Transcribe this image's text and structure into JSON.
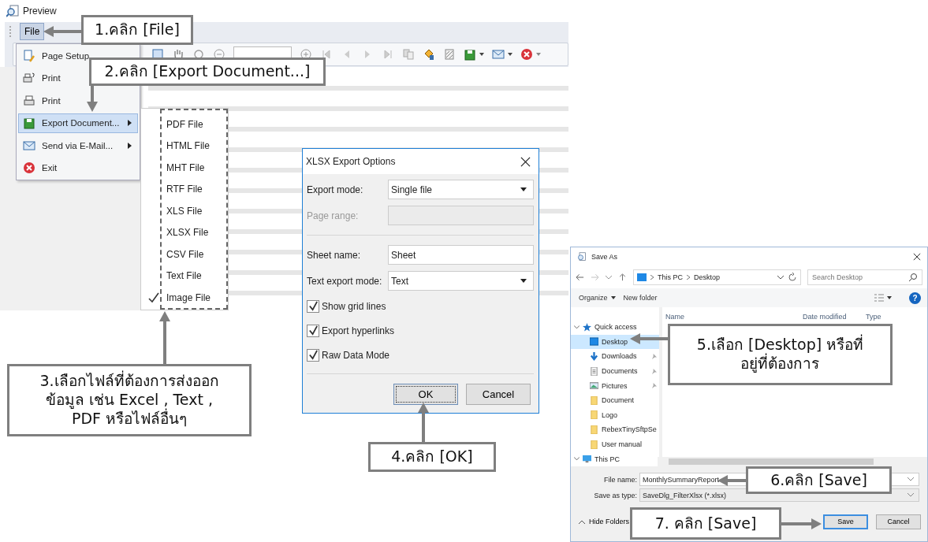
{
  "preview_window": {
    "title": "Preview",
    "menu": [
      {
        "label": "File",
        "selected": true
      }
    ],
    "file_menu": [
      {
        "label": "Page Setup",
        "kind": "page-setup",
        "submenu": false,
        "selected": false
      },
      {
        "label": "Print",
        "kind": "print-dialog",
        "submenu": false,
        "selected": false
      },
      {
        "label": "Print",
        "kind": "print",
        "submenu": false,
        "selected": false
      },
      {
        "label": "Export Document...",
        "kind": "export",
        "submenu": true,
        "selected": true
      },
      {
        "label": "Send via E-Mail...",
        "kind": "email",
        "submenu": true,
        "selected": false
      },
      {
        "label": "Exit",
        "kind": "exit",
        "submenu": false,
        "selected": false
      }
    ],
    "export_submenu": [
      {
        "label": "PDF File",
        "checked": false
      },
      {
        "label": "HTML File",
        "checked": false
      },
      {
        "label": "MHT File",
        "checked": false
      },
      {
        "label": "RTF File",
        "checked": false
      },
      {
        "label": "XLS File",
        "checked": false
      },
      {
        "label": "XLSX File",
        "checked": false
      },
      {
        "label": "CSV File",
        "checked": false
      },
      {
        "label": "Text File",
        "checked": false
      },
      {
        "label": "Image File",
        "checked": true
      }
    ]
  },
  "export_dialog": {
    "title": "XLSX Export Options",
    "fields": [
      {
        "kind": "select",
        "label": "Export mode:",
        "value": "Single file",
        "disabled": false
      },
      {
        "kind": "text",
        "label": "Page range:",
        "disabled": true
      },
      {
        "kind": "text",
        "label": "Sheet name:",
        "value": "Sheet",
        "disabled": false
      },
      {
        "kind": "select",
        "label": "Text export mode:",
        "value": "Text",
        "disabled": false
      }
    ],
    "checkboxes": [
      {
        "label": "Show grid lines",
        "checked": true
      },
      {
        "label": "Export hyperlinks",
        "checked": true
      },
      {
        "label": "Raw Data Mode",
        "checked": true
      }
    ],
    "buttons": [
      {
        "label": "OK",
        "default": true
      },
      {
        "label": "Cancel",
        "default": false
      }
    ]
  },
  "save_dialog": {
    "title": "Save As",
    "path": [
      "This PC",
      "Desktop"
    ],
    "search": {
      "placeholder": "Search Desktop"
    },
    "toolbar": [
      "Organize",
      "New folder"
    ],
    "help": "?",
    "columns": [
      "Name",
      "Date modified",
      "Type"
    ],
    "nav": [
      {
        "label": "Quick access",
        "kind": "star",
        "expanded": true,
        "children": [
          {
            "label": "Desktop",
            "kind": "desktop",
            "pinned": false,
            "selected": true
          },
          {
            "label": "Downloads",
            "kind": "download",
            "pinned": true,
            "selected": false
          },
          {
            "label": "Documents",
            "kind": "documents",
            "pinned": true,
            "selected": false
          },
          {
            "label": "Pictures",
            "kind": "pictures",
            "pinned": true,
            "selected": false
          },
          {
            "label": "Document",
            "kind": "folder",
            "pinned": false,
            "selected": false
          },
          {
            "label": "Logo",
            "kind": "folder",
            "pinned": false,
            "selected": false
          },
          {
            "label": "RebexTinySftpSe",
            "kind": "folder",
            "pinned": false,
            "selected": false
          },
          {
            "label": "User manual",
            "kind": "folder",
            "pinned": false,
            "selected": false
          }
        ]
      },
      {
        "label": "This PC",
        "kind": "pc",
        "expanded": true
      }
    ],
    "file_name": {
      "label": "File name:",
      "value": "MonthlySummaryReport"
    },
    "save_type": {
      "label": "Save as type:",
      "value": "SaveDlg_FilterXlsx (*.xlsx)"
    },
    "hide_folders": "Hide Folders",
    "buttons": [
      {
        "label": "Save",
        "default": true
      },
      {
        "label": "Cancel",
        "default": false
      }
    ]
  },
  "callouts": [
    {
      "text": "1.คลิก [File]"
    },
    {
      "text": "2.คลิก [Export Document...]"
    },
    {
      "text": "3.เลือกไฟล์ที่ต้องการส่งออก\nข้อมูล เช่น Excel , Text ,\nPDF หรือไฟล์อื่นๆ"
    },
    {
      "text": "4.คลิก [OK]"
    },
    {
      "text": "5.เลือก [Desktop] หรือที่\nอยู่ที่ต้องการ"
    },
    {
      "text": "6.คลิก [Save]"
    },
    {
      "text": "7. คลิก [Save]"
    }
  ]
}
